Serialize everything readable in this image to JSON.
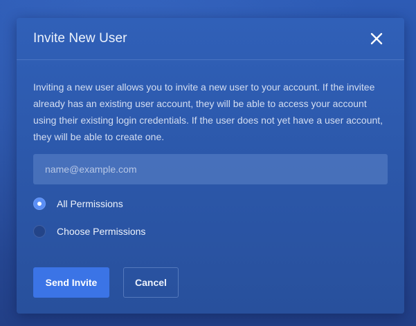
{
  "modal": {
    "title": "Invite New User",
    "description": "Inviting a new user allows you to invite a new user to your account. If the invitee already has an existing user account, they will be able to access your account using their existing login credentials. If the user does not yet have a user account, they will be able to create one.",
    "close_icon": "close-icon"
  },
  "email": {
    "value": "",
    "placeholder": "name@example.com"
  },
  "permissions": {
    "options": [
      {
        "label": "All Permissions",
        "selected": true
      },
      {
        "label": "Choose Permissions",
        "selected": false
      }
    ]
  },
  "actions": {
    "send_label": "Send Invite",
    "cancel_label": "Cancel"
  },
  "colors": {
    "background": "#2a54a8",
    "modal": "#2b56a7",
    "accent": "#3b74e6",
    "radio_selected": "#5a8ef5"
  }
}
